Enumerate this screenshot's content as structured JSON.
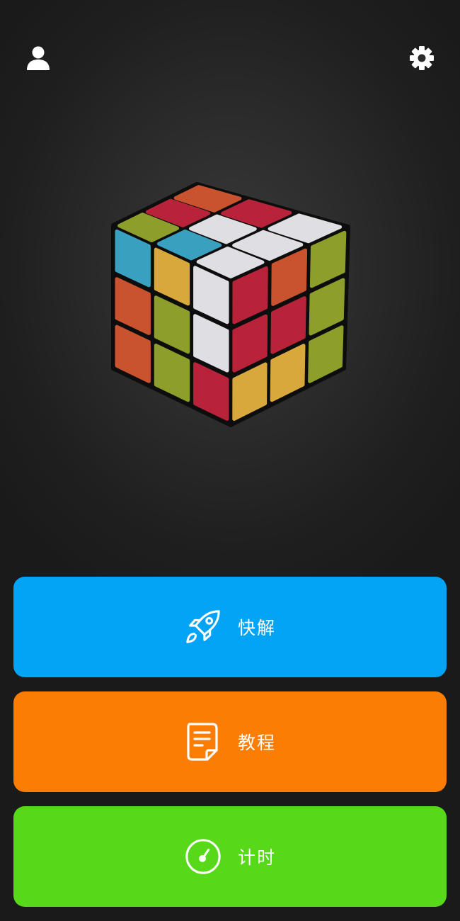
{
  "header": {
    "profile_icon": "user-icon",
    "settings_icon": "gear-icon"
  },
  "cube": {
    "colors": {
      "red": "#b8233a",
      "orange": "#c8532e",
      "blue": "#3aa0bf",
      "white": "#dfdfe3",
      "yellow": "#d9a83c",
      "green": "#8e9e2a"
    }
  },
  "actions": [
    {
      "label": "快解",
      "icon": "rocket-icon",
      "color": "#03a3f5"
    },
    {
      "label": "教程",
      "icon": "document-icon",
      "color": "#fb7d03"
    },
    {
      "label": "计时",
      "icon": "stopwatch-icon",
      "color": "#57d818"
    }
  ]
}
